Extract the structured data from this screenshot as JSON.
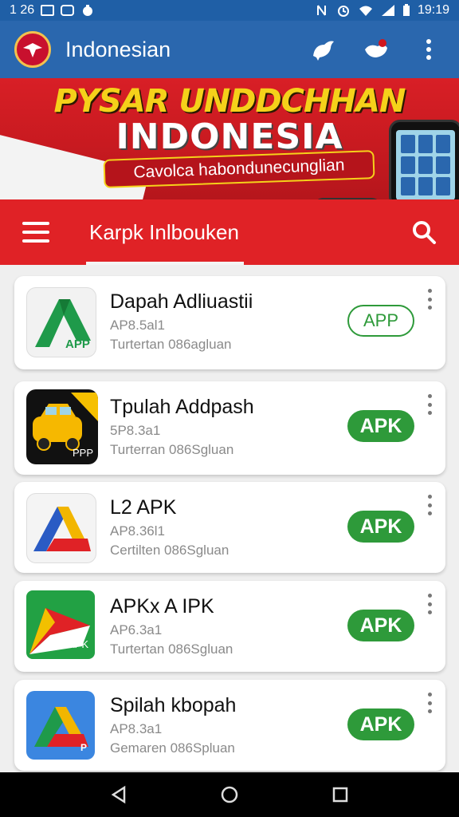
{
  "status_bar": {
    "left_text": "1 26",
    "time": "19:19"
  },
  "app_bar": {
    "title": "Indonesian"
  },
  "banner": {
    "headline": "PYSAR UNDDCHHAN",
    "subheadline": "INDONESIA",
    "tagline": "Cavolca habondunecunglian"
  },
  "toolbar": {
    "title": "Karpk Inlbouken"
  },
  "apps": [
    {
      "name": "Dapah Adliuastii",
      "version": "AP8.5al1",
      "publisher": "Turtertan 086agluan",
      "button": "APP",
      "button_style": "outline"
    },
    {
      "name": "Tpulah Addpash",
      "version": "5P8.3a1",
      "publisher": "Turterran 086Sgluan",
      "button": "APK",
      "button_style": "solid",
      "thumb_text": "PPP"
    },
    {
      "name": "L2 APK",
      "version": "AP8.36l1",
      "publisher": "Certilten 086Sgluan",
      "button": "APK",
      "button_style": "solid"
    },
    {
      "name": "APKx A IPK",
      "version": "AP6.3a1",
      "publisher": "Turtertan 086Sgluan",
      "button": "APK",
      "button_style": "solid",
      "thumb_text": "APK"
    },
    {
      "name": "Spilah kbopah",
      "version": "AP8.3a1",
      "publisher": "Gemaren 086Spluan",
      "button": "APK",
      "button_style": "solid",
      "thumb_text": "P"
    }
  ],
  "thumb1_text": "APP",
  "colors": {
    "status_bar": "#1f5fa6",
    "app_bar": "#2a67ae",
    "toolbar": "#e02226",
    "button_green": "#2e9a3a"
  }
}
